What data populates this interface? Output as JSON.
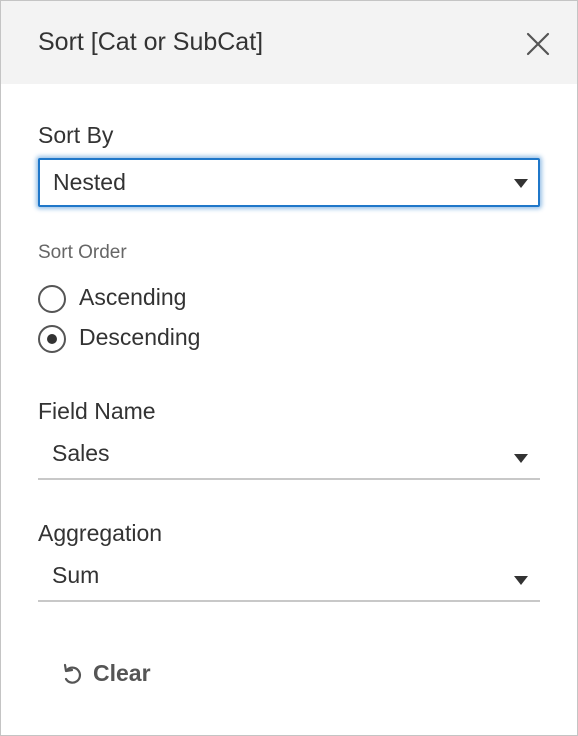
{
  "dialog": {
    "title": "Sort [Cat or SubCat]",
    "close_icon": "close-icon"
  },
  "sort_by": {
    "label": "Sort By",
    "value": "Nested"
  },
  "sort_order": {
    "label": "Sort Order",
    "options": [
      {
        "label": "Ascending",
        "selected": false
      },
      {
        "label": "Descending",
        "selected": true
      }
    ]
  },
  "field_name": {
    "label": "Field Name",
    "value": "Sales"
  },
  "aggregation": {
    "label": "Aggregation",
    "value": "Sum"
  },
  "clear": {
    "label": "Clear",
    "icon": "undo-icon"
  },
  "colors": {
    "focus_accent": "#1f77c9",
    "header_bg": "#f3f3f3"
  }
}
